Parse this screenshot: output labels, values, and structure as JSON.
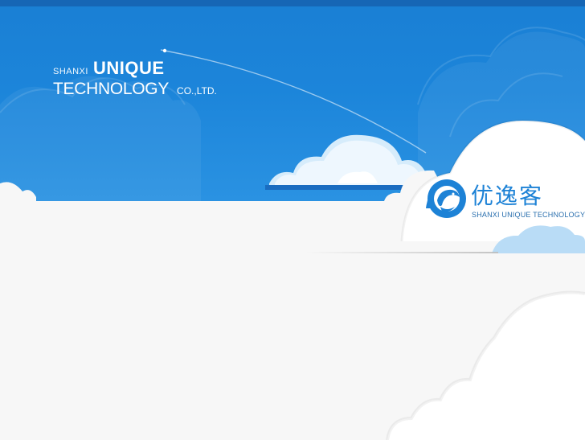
{
  "banner": {
    "company_prefix": "SHANXI",
    "company_highlight": "UNIQUE",
    "company_line2": "TECHNOLOGY",
    "company_suffix": "CO.,LTD."
  },
  "logo": {
    "chinese_name": "优逸客",
    "english_name": "SHANXI UNIQUE TECHNOLOGY",
    "mark_icon": "dolphin-wave-icon"
  },
  "colors": {
    "sky_blue": "#1c85da",
    "logo_blue": "#1d82d6",
    "content_bg": "#f7f7f7"
  }
}
